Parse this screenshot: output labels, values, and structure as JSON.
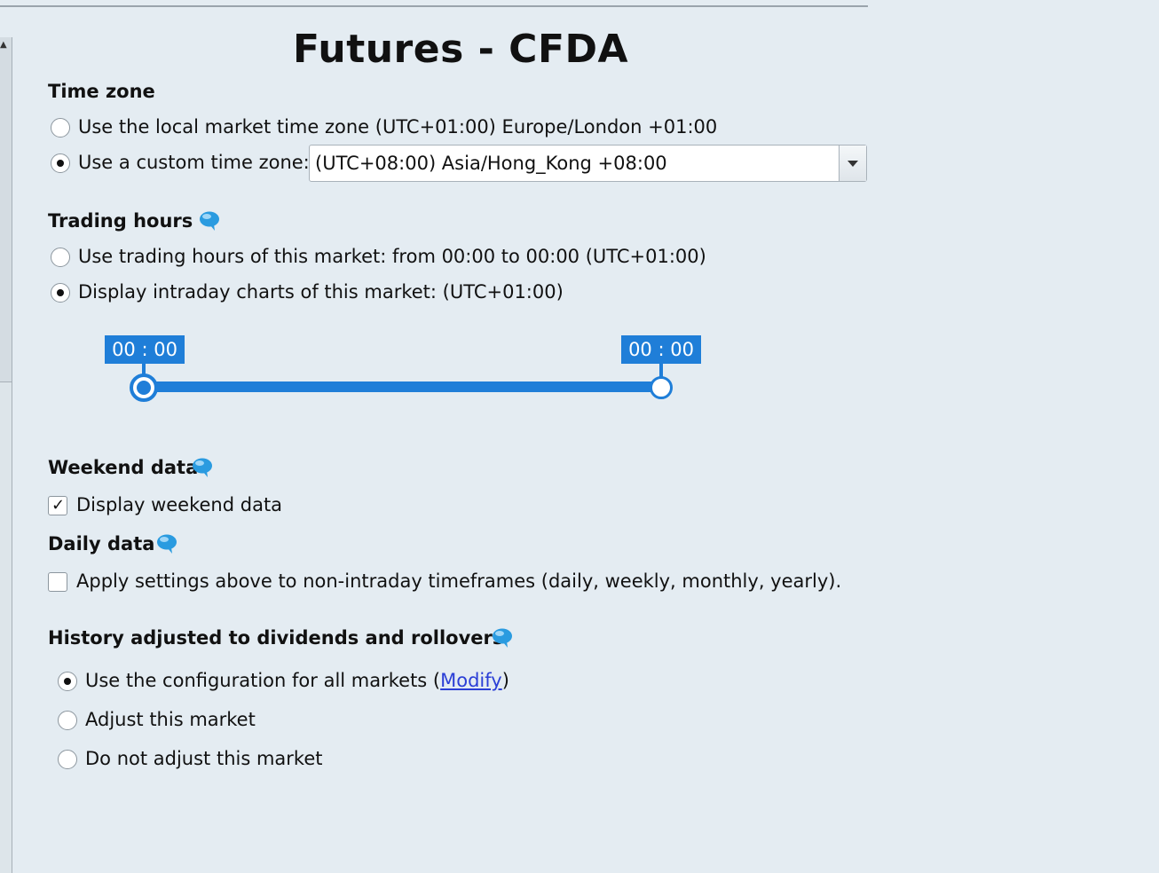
{
  "title": "Futures - CFDA",
  "time_zone": {
    "heading": "Time zone",
    "option_local": "Use the local market time zone (UTC+01:00) Europe/London +01:00",
    "option_custom": "Use a custom time zone:",
    "selected_option": "custom",
    "custom_value": "(UTC+08:00) Asia/Hong_Kong +08:00"
  },
  "trading_hours": {
    "heading": "Trading hours",
    "option_market": "Use trading hours of this market: from 00:00 to 00:00  (UTC+01:00)",
    "option_display": "Display intraday charts of this market:  (UTC+01:00)",
    "selected_option": "display",
    "range_start": "00 : 00",
    "range_end": "00 : 00"
  },
  "weekend_data": {
    "heading": "Weekend data",
    "checkbox_label": "Display weekend data",
    "checked": true
  },
  "daily_data": {
    "heading": "Daily data",
    "checkbox_label": "Apply settings above to non-intraday timeframes (daily, weekly, monthly, yearly).",
    "checked": false
  },
  "history": {
    "heading": "History adjusted to dividends and rollovers",
    "option_config_prefix": "Use the configuration for all markets (",
    "option_config_link": "Modify",
    "option_config_suffix": ")",
    "option_adjust": "Adjust this market",
    "option_no_adjust": "Do not adjust this market",
    "selected_option": "config"
  },
  "colors": {
    "accent": "#1f7ed8",
    "background": "#e4ecf2",
    "link": "#2b3fd6"
  }
}
